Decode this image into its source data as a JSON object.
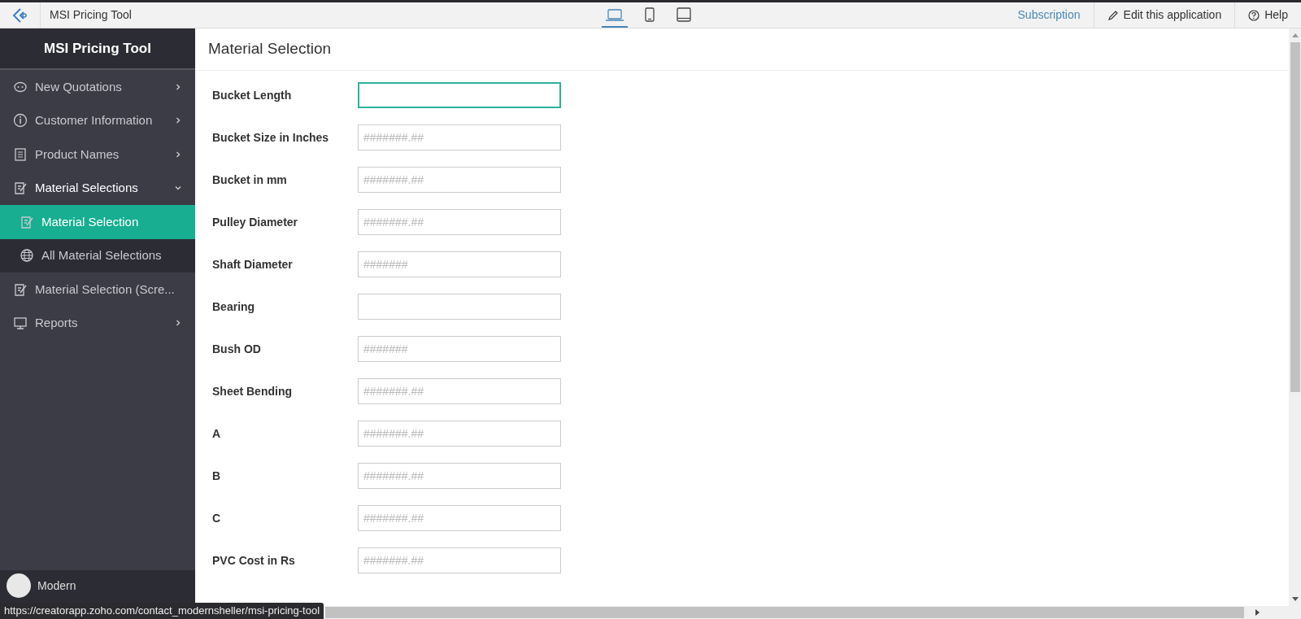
{
  "topbar": {
    "app_title": "MSI Pricing Tool",
    "devices": [
      {
        "kind": "laptop",
        "selected": true
      },
      {
        "kind": "phone",
        "selected": false
      },
      {
        "kind": "tablet",
        "selected": false
      }
    ],
    "subscription": "Subscription",
    "edit": "Edit this application",
    "help": "Help"
  },
  "sidebar": {
    "title": "MSI Pricing Tool",
    "items": [
      {
        "kind": "face",
        "label": "New Quotations",
        "expanded": false,
        "selected": false
      },
      {
        "kind": "info",
        "label": "Customer Information",
        "expanded": false,
        "selected": false
      },
      {
        "kind": "list",
        "label": "Product Names",
        "expanded": false,
        "selected": false
      },
      {
        "kind": "form",
        "label": "Material Selections",
        "expanded": true,
        "selected": false,
        "children": [
          {
            "kind": "form",
            "label": "Material Selection",
            "selected": true
          },
          {
            "kind": "globe",
            "label": "All Material Selections",
            "selected": false
          }
        ]
      },
      {
        "kind": "form",
        "label": "Material Selection (Scre...",
        "expanded": false,
        "selected": false
      },
      {
        "kind": "monitor",
        "label": "Reports",
        "expanded": false,
        "selected": false
      }
    ],
    "user": "Modern"
  },
  "form": {
    "title": "Material Selection",
    "fields": [
      {
        "label": "Bucket Length",
        "focused": true
      },
      {
        "label": "Bucket Size in Inches",
        "placeholder": "#######.##",
        "focused": false
      },
      {
        "label": "Bucket in mm",
        "placeholder": "#######.##",
        "focused": false
      },
      {
        "label": "Pulley Diameter",
        "placeholder": "#######.##",
        "focused": false
      },
      {
        "label": "Shaft Diameter",
        "placeholder": "#######",
        "focused": false
      },
      {
        "label": "Bearing",
        "focused": false
      },
      {
        "label": "Bush OD",
        "placeholder": "#######",
        "focused": false
      },
      {
        "label": "Sheet Bending",
        "placeholder": "#######.##",
        "focused": false
      },
      {
        "label": "A",
        "placeholder": "#######.##",
        "focused": false
      },
      {
        "label": "B",
        "placeholder": "#######.##",
        "focused": false
      },
      {
        "label": "C",
        "placeholder": "#######.##",
        "focused": false
      },
      {
        "label": "PVC Cost in Rs",
        "placeholder": "#######.##",
        "focused": false
      }
    ]
  },
  "status_url": "https://creatorapp.zoho.com/contact_modernsheller/msi-pricing-tool"
}
